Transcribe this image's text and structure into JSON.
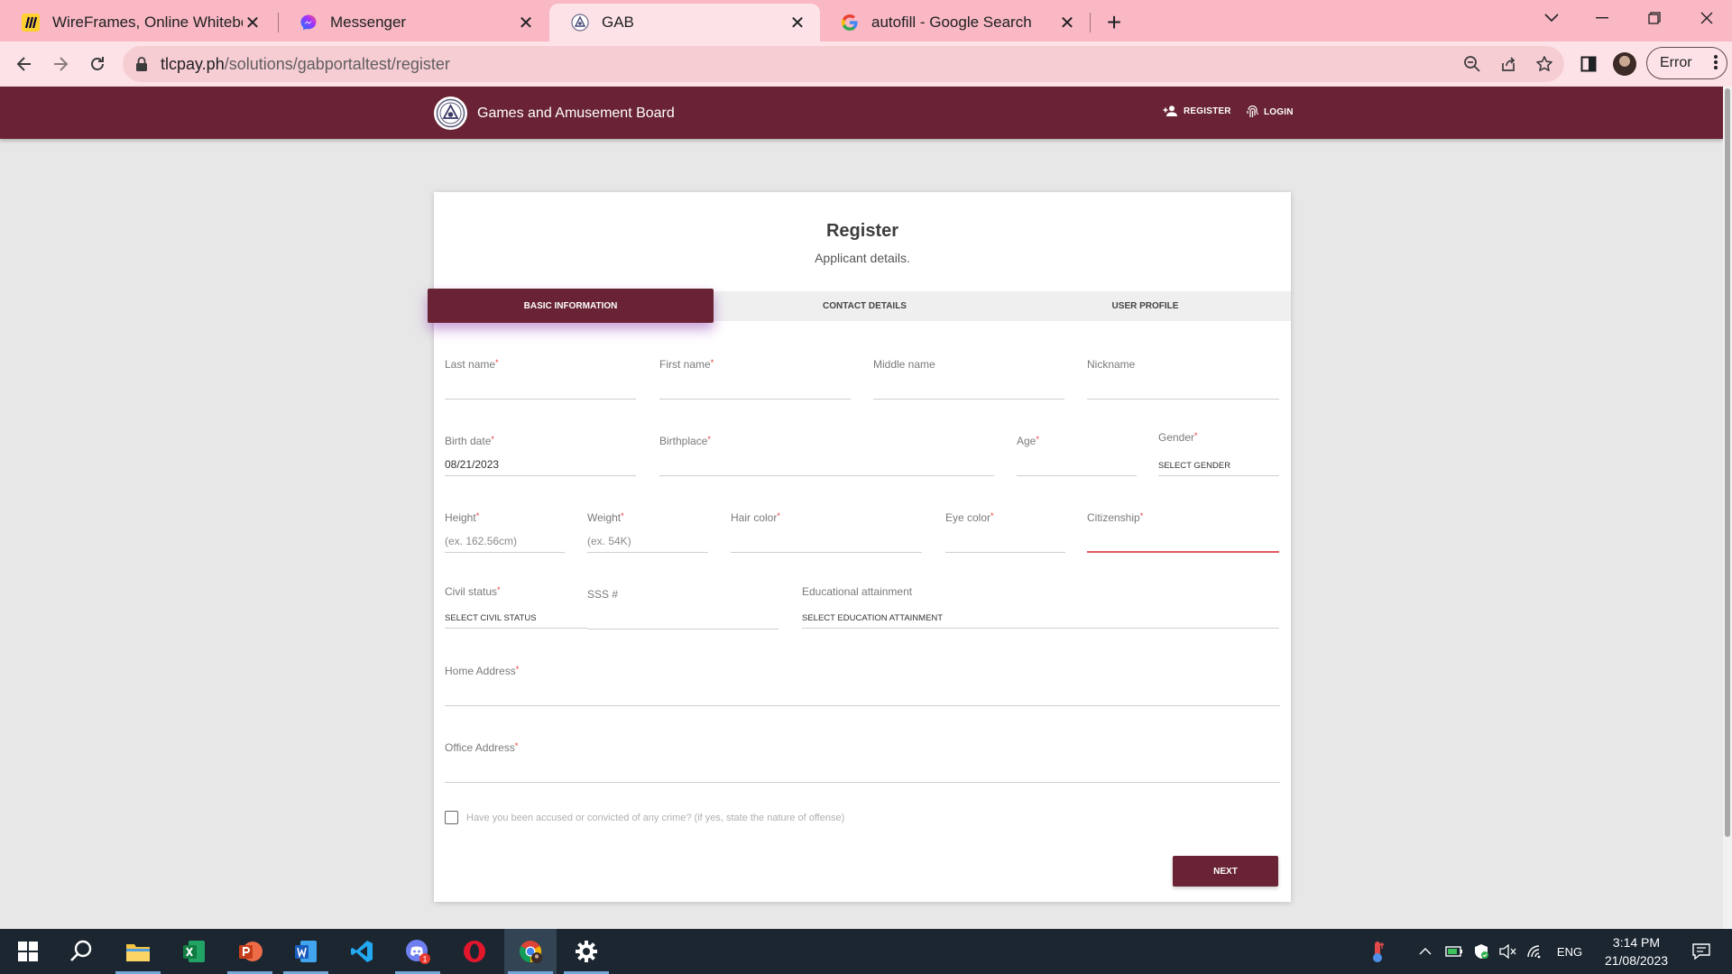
{
  "browser": {
    "tabs": [
      {
        "title": "WireFrames, Online Whiteboard | Miro",
        "icon": "miro-icon"
      },
      {
        "title": "Messenger",
        "icon": "messenger-icon"
      },
      {
        "title": "GAB",
        "icon": "gab-icon",
        "active": true
      },
      {
        "title": "autofill - Google Search",
        "icon": "google-icon"
      }
    ],
    "url_host": "tlcpay.ph",
    "url_path": "/solutions/gabportaltest/register",
    "profile_status": "Error"
  },
  "site": {
    "brand": "Games and Amusement Board",
    "nav": {
      "register": "REGISTER",
      "login": "LOGIN"
    }
  },
  "form": {
    "title": "Register",
    "subtitle": "Applicant details.",
    "steps": [
      "BASIC INFORMATION",
      "CONTACT DETAILS",
      "USER PROFILE"
    ],
    "fields": {
      "last_name": {
        "label": "Last name",
        "value": ""
      },
      "first_name": {
        "label": "First name",
        "value": ""
      },
      "middle_name": {
        "label": "Middle name",
        "value": ""
      },
      "nickname": {
        "label": "Nickname",
        "value": ""
      },
      "birth_date": {
        "label": "Birth date",
        "value": "08/21/2023"
      },
      "birthplace": {
        "label": "Birthplace",
        "value": ""
      },
      "age": {
        "label": "Age",
        "value": ""
      },
      "gender": {
        "label": "Gender",
        "value": "SELECT GENDER"
      },
      "height": {
        "label": "Height",
        "placeholder": "(ex. 162.56cm)"
      },
      "weight": {
        "label": "Weight",
        "placeholder": "(ex. 54K)"
      },
      "hair_color": {
        "label": "Hair color",
        "value": ""
      },
      "eye_color": {
        "label": "Eye color",
        "value": ""
      },
      "citizenship": {
        "label": "Citizenship",
        "value": ""
      },
      "civil_status": {
        "label": "Civil status",
        "value": "SELECT CIVIL STATUS"
      },
      "sss": {
        "label": "SSS #",
        "value": ""
      },
      "education": {
        "label": "Educational attainment",
        "value": "SELECT EDUCATION ATTAINMENT"
      },
      "home_address": {
        "label": "Home Address",
        "value": ""
      },
      "office_address": {
        "label": "Office Address",
        "value": ""
      }
    },
    "crime_question": "Have you been accused or convicted of any crime? (if yes, state the nature of offense)",
    "next_label": "NEXT",
    "accent_color": "#692334",
    "required_color": "#e53935"
  },
  "taskbar": {
    "apps": [
      "windows-start",
      "search",
      "file-explorer",
      "excel",
      "powerpoint",
      "word",
      "vscode",
      "discord",
      "opera",
      "chrome",
      "settings"
    ],
    "discord_badge": "1",
    "language": "ENG",
    "time": "3:14 PM",
    "date": "21/08/2023"
  }
}
